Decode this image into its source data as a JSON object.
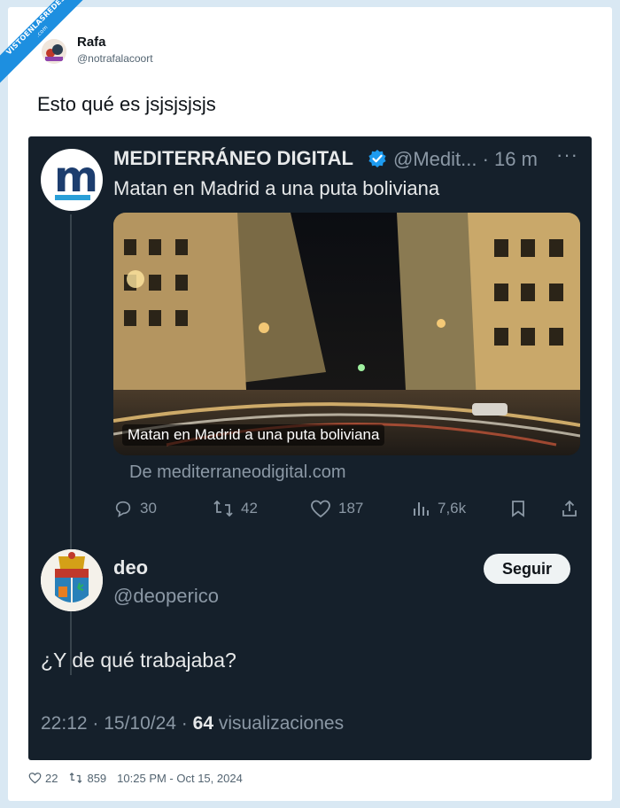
{
  "watermark": {
    "text": "VISTOENLASREDES",
    "sub": ".com"
  },
  "author": {
    "name": "Rafa",
    "handle": "@notrafalacoort"
  },
  "tweet": {
    "text": "Esto qué es jsjsjsjsjs"
  },
  "quoted": {
    "name": "MEDITERRÁNEO DIGITAL",
    "handle_time": "@Medit... · 16 m",
    "more": "···",
    "text": "Matan en Madrid a una puta boliviana",
    "media_caption": "Matan en Madrid a una puta boliviana",
    "source": "De mediterraneodigital.com",
    "replies": "30",
    "retweets": "42",
    "likes": "187",
    "views": "7,6k"
  },
  "reply": {
    "name": "deo",
    "handle": "@deoperico",
    "follow_label": "Seguir",
    "text": "¿Y de qué trabajaba?",
    "timestamp": "22:12 · 15/10/24 ·",
    "views_count": "64",
    "views_label": "visualizaciones"
  },
  "footer": {
    "likes": "22",
    "retweets": "859",
    "date": "10:25 PM - Oct 15, 2024"
  },
  "colors": {
    "dark_bg": "#15202b",
    "muted": "#8b98a5",
    "verified": "#1d9bf0",
    "watermark": "#1d8fe0"
  }
}
